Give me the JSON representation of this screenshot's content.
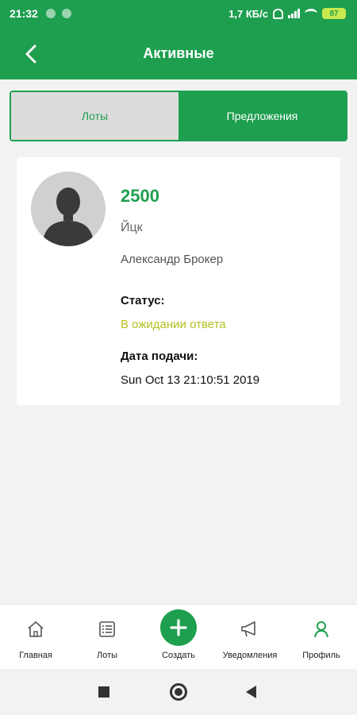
{
  "status_bar": {
    "time": "21:32",
    "network_speed": "1,7 КБ/с",
    "battery": "87",
    "icons": [
      "notification-dot-icon",
      "notification-dot-icon",
      "bell-muted-icon",
      "signal-icon",
      "wifi-icon",
      "battery-icon"
    ]
  },
  "app_bar": {
    "title": "Активные",
    "back_icon": "chevron-left-icon"
  },
  "tabs": [
    {
      "label": "Лоты",
      "selected": false
    },
    {
      "label": "Предложения",
      "selected": true
    }
  ],
  "offer": {
    "price": "2500",
    "lot_name": "Йцк",
    "broker": "Александр Брокер",
    "status_label": "Статус:",
    "status_value": "В ожидании ответа",
    "date_label": "Дата подачи:",
    "date_value": "Sun Oct 13 21:10:51 2019",
    "avatar_icon": "person-silhouette-icon"
  },
  "bottom_nav": [
    {
      "label": "Главная",
      "icon": "home-icon"
    },
    {
      "label": "Лоты",
      "icon": "list-icon"
    },
    {
      "label": "Создать",
      "icon": "plus-icon"
    },
    {
      "label": "Уведомления",
      "icon": "megaphone-icon"
    },
    {
      "label": "Профиль",
      "icon": "person-icon",
      "active": true
    }
  ],
  "system_nav": [
    "square-icon",
    "circle-home-icon",
    "triangle-back-icon"
  ],
  "colors": {
    "primary": "#1e9f4f",
    "status_pending": "#b6c020",
    "background": "#f2f2f2"
  }
}
